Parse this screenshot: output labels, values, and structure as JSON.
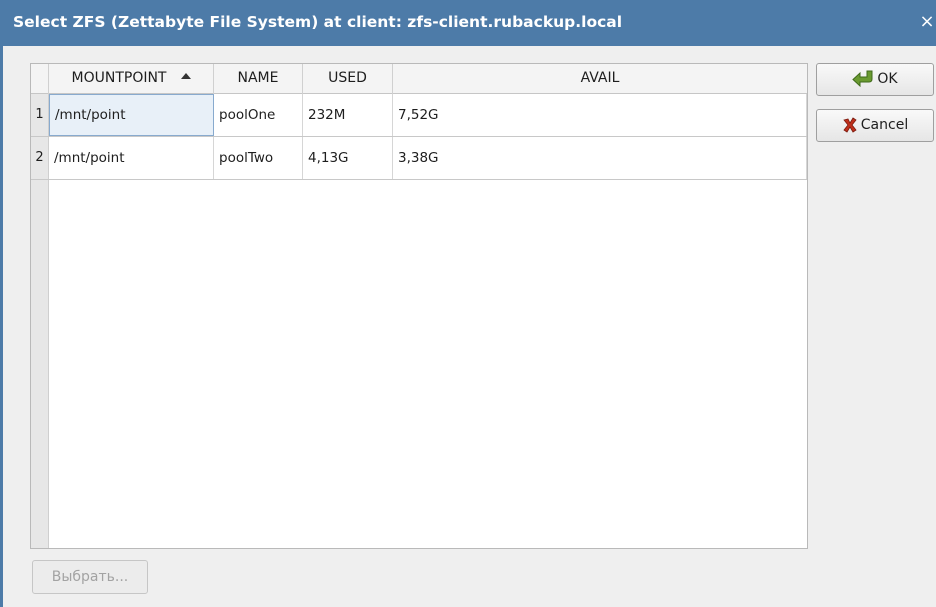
{
  "window": {
    "title": "Select ZFS (Zettabyte File System) at client: zfs-client.rubackup.local",
    "close_glyph": "×"
  },
  "table": {
    "columns": [
      "MOUNTPOINT",
      "NAME",
      "USED",
      "AVAIL"
    ],
    "sort_column": "MOUNTPOINT",
    "sort_order": "ascending",
    "rows": [
      {
        "num": "1",
        "mountpoint": "/mnt/point",
        "name": "poolOne",
        "used": "232M",
        "avail": "7,52G"
      },
      {
        "num": "2",
        "mountpoint": "/mnt/point",
        "name": "poolTwo",
        "used": "4,13G",
        "avail": "3,38G"
      }
    ]
  },
  "buttons": {
    "ok": "OK",
    "cancel": "Cancel",
    "choose": "Выбрать..."
  },
  "icons": {
    "ok": "green-arrow-icon",
    "cancel": "red-x-icon",
    "close": "close-icon",
    "sort": "sort-ascending-icon"
  },
  "colors": {
    "titlebar": "#4d7ba8",
    "selection": "#e8f0f8",
    "ok_icon": "#5a8a2a",
    "cancel_icon": "#b22a1a"
  }
}
